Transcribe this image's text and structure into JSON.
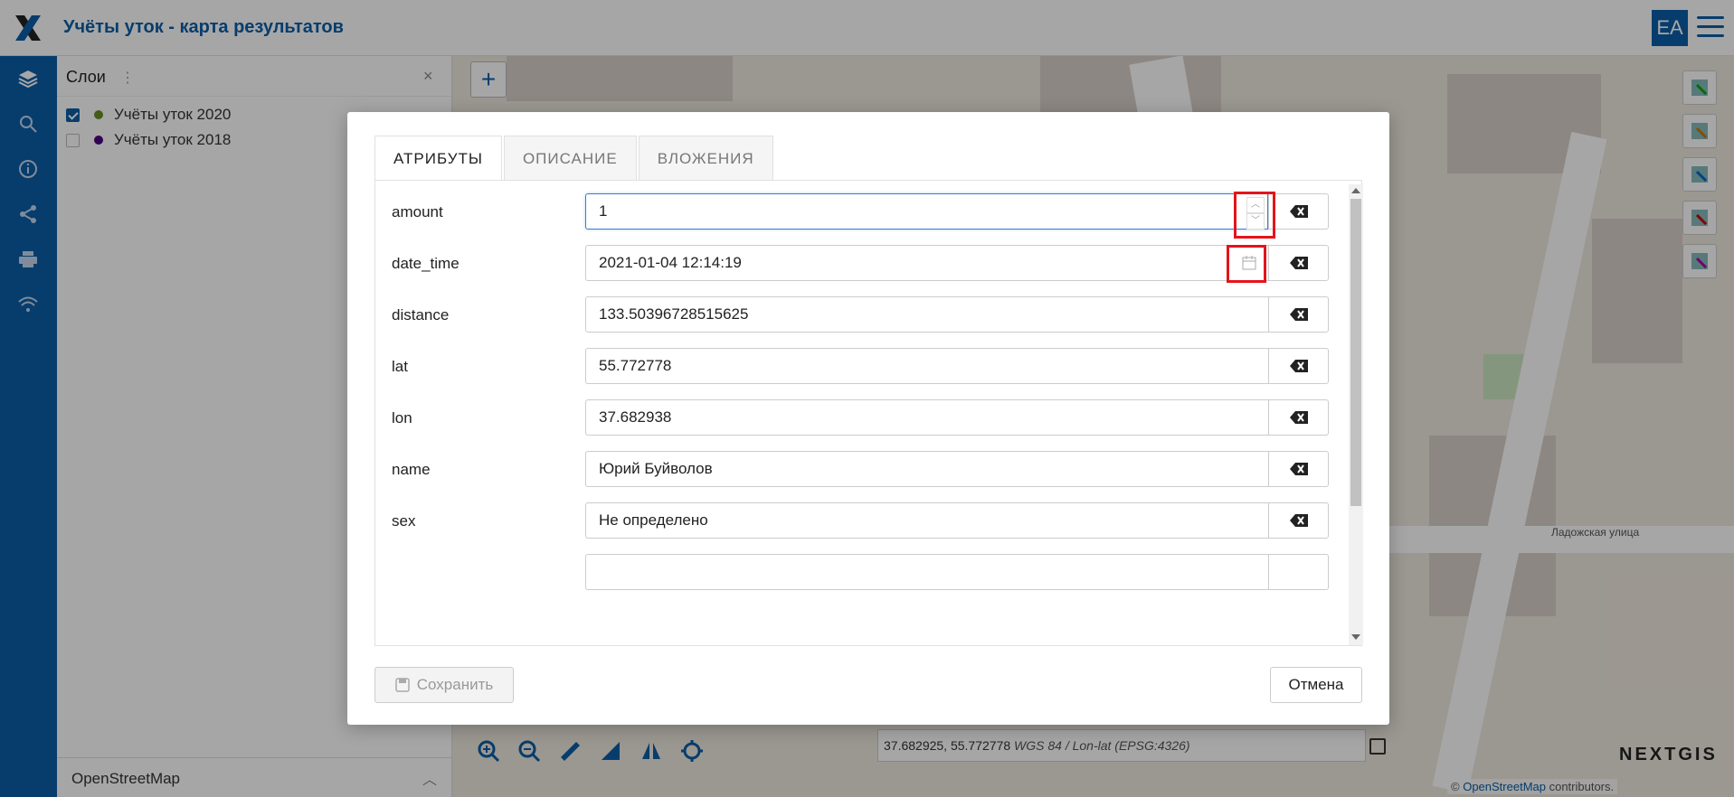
{
  "header": {
    "title": "Учёты уток - карта результатов",
    "avatar": "EA"
  },
  "nav": {
    "icons": [
      "layers-icon",
      "search-icon",
      "info-icon",
      "share-icon",
      "print-icon",
      "wifi-icon"
    ]
  },
  "layers_panel": {
    "title": "Слои",
    "layers": [
      {
        "label": "Учёты уток 2020",
        "checked": true,
        "color": "#6b8e23"
      },
      {
        "label": "Учёты уток 2018",
        "checked": false,
        "color": "#4b0082"
      }
    ],
    "basemap": "OpenStreetMap"
  },
  "map": {
    "coords": "37.682925, 55.772778",
    "crs": "WGS 84 / Lon-lat (EPSG:4326)",
    "brand": "NEXTGIS",
    "attribution_prefix": "© ",
    "attribution_link": "OpenStreetMap",
    "attribution_suffix": " contributors."
  },
  "dialog": {
    "tabs": [
      "АТРИБУТЫ",
      "ОПИСАНИЕ",
      "ВЛОЖЕНИЯ"
    ],
    "fields": [
      {
        "label": "amount",
        "value": "1"
      },
      {
        "label": "date_time",
        "value": "2021-01-04 12:14:19"
      },
      {
        "label": "distance",
        "value": "133.50396728515625"
      },
      {
        "label": "lat",
        "value": "55.772778"
      },
      {
        "label": "lon",
        "value": "37.682938"
      },
      {
        "label": "name",
        "value": "Юрий Буйволов"
      },
      {
        "label": "sex",
        "value": "Не определено"
      }
    ],
    "save_label": "Сохранить",
    "cancel_label": "Отмена"
  },
  "colors": {
    "brand": "#0b5ea8",
    "highlight": "#e4141b"
  }
}
